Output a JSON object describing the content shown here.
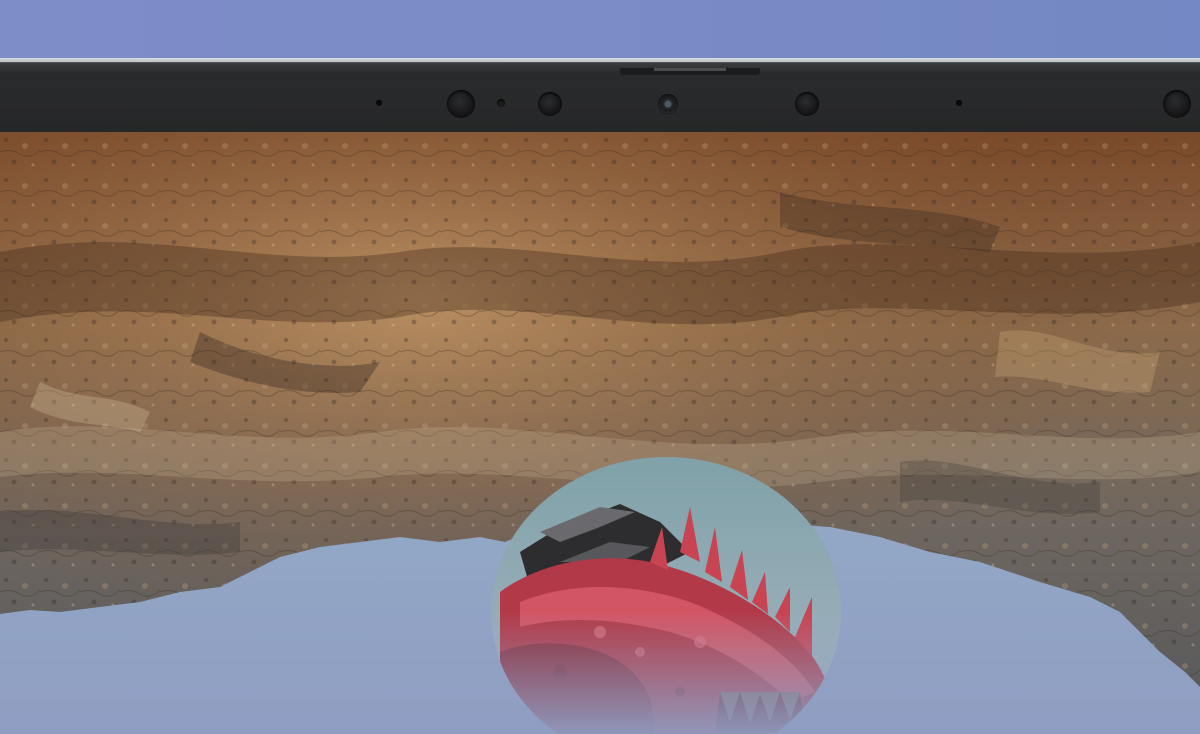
{
  "image": {
    "subject": "laptop-screen-closeup",
    "colors": {
      "background_top": "#7e8dc8",
      "bezel": "#2a2b2c",
      "rock_warm": "#8a5a34",
      "rock_cool": "#6c6a66",
      "sky": "#9fb6c8",
      "dragon": "#b8424e"
    }
  },
  "icons": {
    "webcam": "webcam-icon",
    "sensors": "sensor-dot",
    "dragon": "dragon-portrait"
  }
}
